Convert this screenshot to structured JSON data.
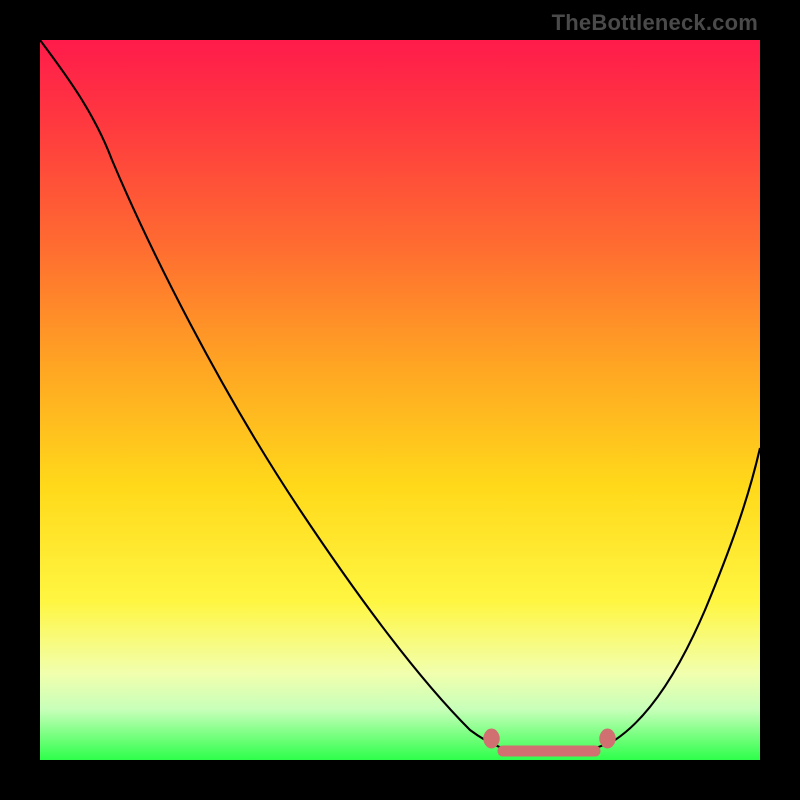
{
  "attribution": "TheBottleneck.com",
  "chart_data": {
    "type": "line",
    "title": "",
    "xlabel": "",
    "ylabel": "",
    "xlim": [
      0,
      100
    ],
    "ylim": [
      0,
      100
    ],
    "series": [
      {
        "name": "bottleneck-curve",
        "x": [
          0,
          5,
          10,
          15,
          20,
          25,
          30,
          35,
          40,
          45,
          50,
          55,
          60,
          63,
          66,
          70,
          73,
          76,
          80,
          84,
          88,
          92,
          96,
          100
        ],
        "y": [
          100,
          94,
          87,
          80,
          73,
          66,
          58,
          50,
          42,
          34,
          26,
          19,
          12,
          8,
          5,
          3,
          2,
          2,
          3,
          6,
          13,
          22,
          33,
          44
        ]
      }
    ],
    "annotations": [
      {
        "name": "valley-markers",
        "shape": "lozenge-dots",
        "x_range": [
          62,
          80
        ],
        "y": 2,
        "color": "#d07070"
      }
    ],
    "background_gradient": {
      "top": "#ff1b4b",
      "upper_mid": "#ffa423",
      "lower_mid": "#fff642",
      "bottom": "#2dff4a"
    }
  }
}
